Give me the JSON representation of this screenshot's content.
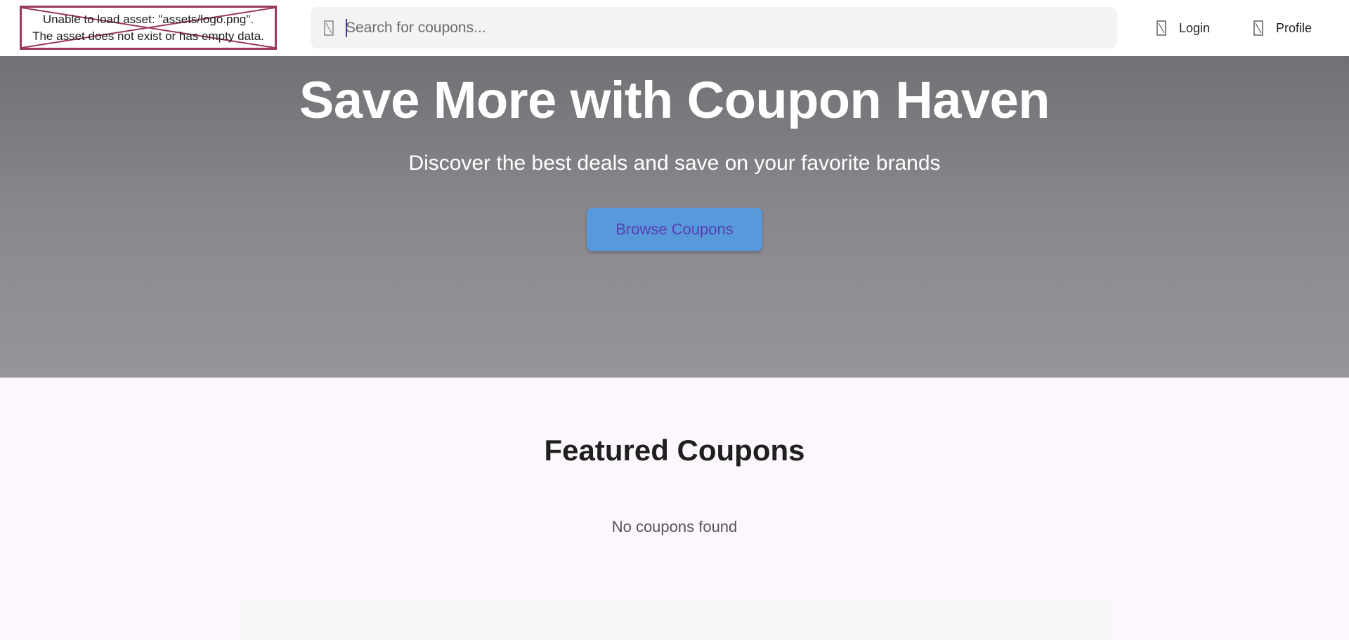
{
  "header": {
    "logo_error": {
      "line1": "Unable to load asset: \"assets/logo.png\".",
      "line2": "The asset does not exist or has empty data."
    },
    "search": {
      "placeholder": "Search for coupons...",
      "value": "",
      "icon": "search-icon"
    },
    "nav": {
      "login_label": "Login",
      "login_icon": "login-icon",
      "profile_label": "Profile",
      "profile_icon": "profile-icon"
    }
  },
  "hero": {
    "title": "Save More with Coupon Haven",
    "subtitle": "Discover the best deals and save on your favorite brands",
    "cta_label": "Browse Coupons"
  },
  "featured": {
    "title": "Featured Coupons",
    "empty_message": "No coupons found"
  },
  "colors": {
    "error_border": "#9b3a55",
    "hero_top": "#727074",
    "hero_bottom": "#97959b",
    "cta_bg": "#5899dc",
    "cta_text": "#5a3fb0",
    "page_bg": "#fcf7fc"
  }
}
